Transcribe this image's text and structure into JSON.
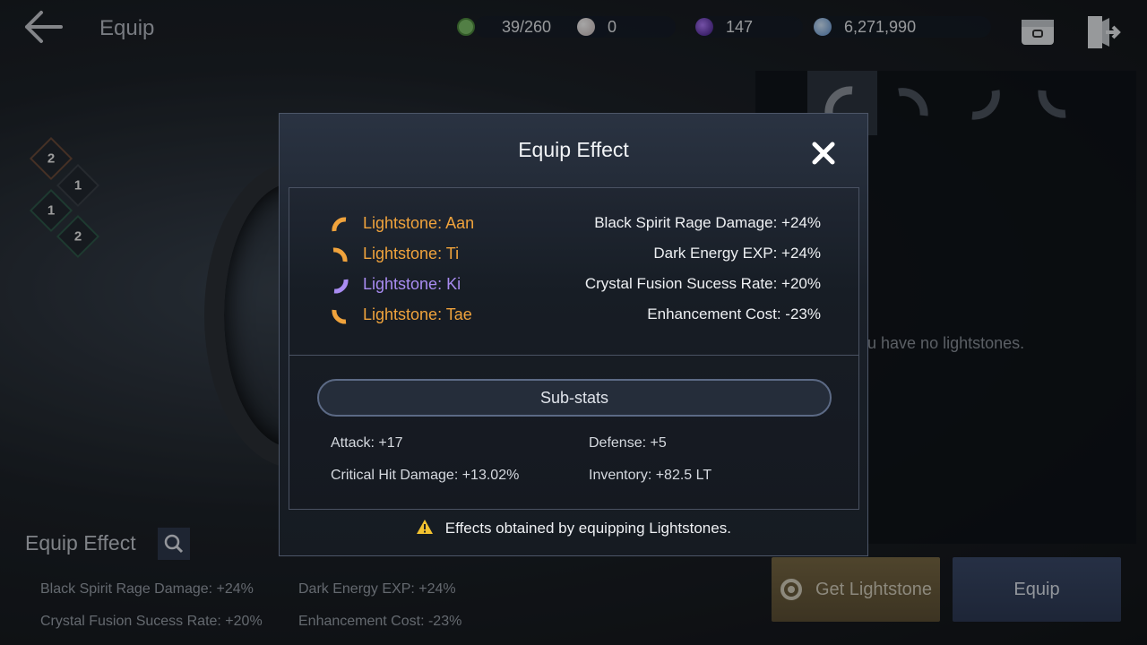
{
  "header": {
    "title": "Equip",
    "resources": [
      {
        "icon": "energy-icon",
        "value": "39/260",
        "color": "#7fc36a"
      },
      {
        "icon": "pearl-icon",
        "value": "0",
        "color": "#e6dede"
      },
      {
        "icon": "dark-orb-icon",
        "value": "147",
        "color": "#7a3dd6"
      },
      {
        "icon": "silver-icon",
        "value": "6,271,990",
        "color": "#6aa4e0"
      }
    ]
  },
  "skills": [
    {
      "icon": "skill-icon",
      "level": "2"
    },
    {
      "icon": "skill-icon",
      "level": "1"
    },
    {
      "icon": "skill-icon",
      "level": "1"
    },
    {
      "icon": "skill-icon",
      "level": "2"
    }
  ],
  "right_panel": {
    "empty_message": "ou have no lightstones.",
    "get_button": "Get Lightstone",
    "equip_button": "Equip"
  },
  "equip_effect": {
    "title": "Equip Effect",
    "stats": [
      "Black Spirit Rage Damage: +24%",
      "Dark Energy EXP: +24%",
      "Crystal Fusion Sucess Rate: +20%",
      "Enhancement Cost: -23%"
    ]
  },
  "modal": {
    "title": "Equip Effect",
    "lightstones": [
      {
        "name": "Lightstone: Aan",
        "effect": "Black Spirit Rage Damage: +24%",
        "color": "#f0a33c"
      },
      {
        "name": "Lightstone: Ti",
        "effect": "Dark Energy EXP: +24%",
        "color": "#f0a33c"
      },
      {
        "name": "Lightstone: Ki",
        "effect": "Crystal Fusion Sucess Rate: +20%",
        "color": "#a98cf2"
      },
      {
        "name": "Lightstone: Tae",
        "effect": "Enhancement Cost: -23%",
        "color": "#f0a33c"
      }
    ],
    "substats_label": "Sub-stats",
    "substats": [
      "Attack: +17",
      "Defense: +5",
      "Critical Hit Damage: +13.02%",
      "Inventory: +82.5 LT"
    ],
    "footnote": "Effects obtained by equipping Lightstones."
  }
}
